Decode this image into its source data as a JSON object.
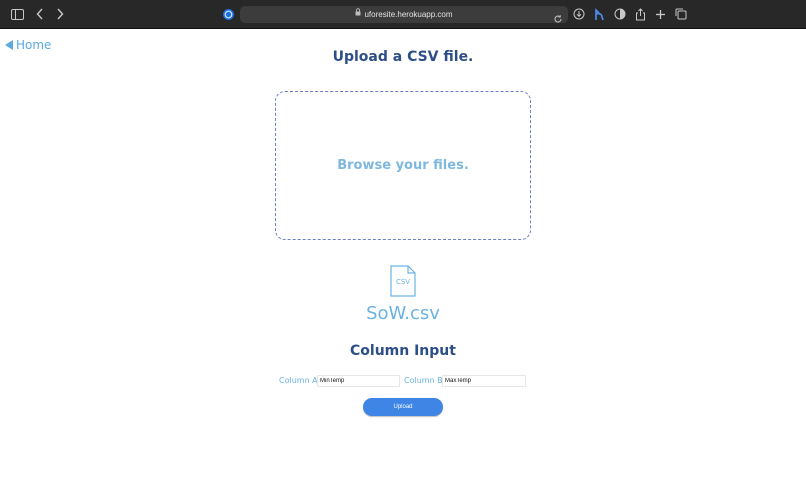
{
  "browser": {
    "url": "uforesite.herokuapp.com"
  },
  "page": {
    "home_label": "Home",
    "title": "Upload a CSV file.",
    "dropzone_text": "Browse your files.",
    "file_icon_label": "CSV",
    "file_name": "SoW.csv",
    "section_title": "Column Input",
    "column_a": {
      "label": "Column A",
      "value": "MinTemp"
    },
    "column_b": {
      "label": "Column B",
      "value": "MaxTemp"
    },
    "upload_label": "Upload"
  },
  "icons": {
    "sidebar": "sidebar-toggle-icon",
    "back": "chevron-left-icon",
    "forward": "chevron-right-icon",
    "site": "site-favicon-icon",
    "lock": "lock-icon",
    "reload": "reload-icon",
    "download": "download-icon",
    "extension": "extension-icon",
    "shield": "privacy-shield-icon",
    "share": "share-icon",
    "new_tab": "new-tab-icon",
    "tabs": "tab-overview-icon",
    "file": "csv-file-icon",
    "home_arrow": "back-triangle-icon"
  },
  "colors": {
    "toolbar": "#282828",
    "accent_blue": "#5aa9e0",
    "heading": "#2d4e86",
    "button": "#3f85e6",
    "dropzone_border": "#6c7fc4"
  }
}
